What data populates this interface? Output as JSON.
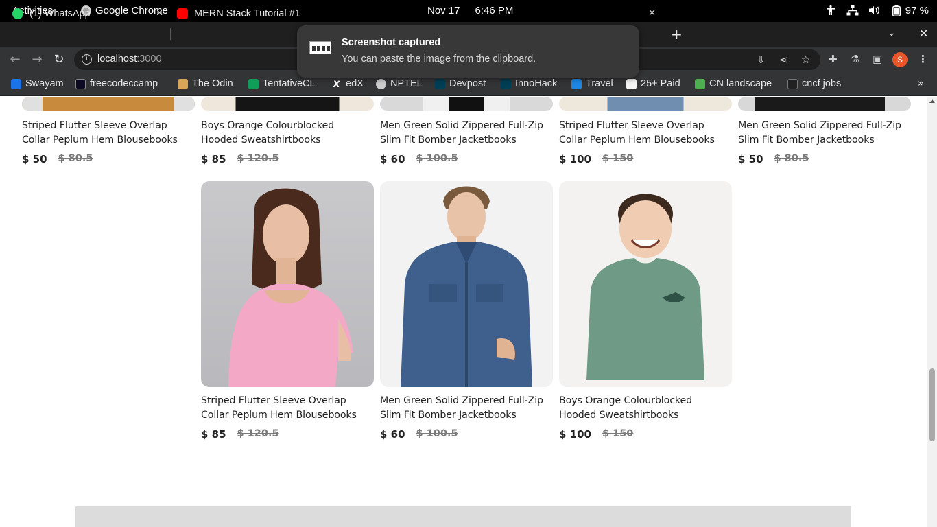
{
  "topbar": {
    "activities": "Activities",
    "app_name": "Google Chrome",
    "date": "Nov 17",
    "time": "6:46 PM",
    "battery": "97 %"
  },
  "tabs": [
    {
      "label": "(1) WhatsApp",
      "favicon_color": "#25d366"
    },
    {
      "label": "MERN Stack Tutorial #1",
      "favicon_color": "#ff0000"
    }
  ],
  "toolbar": {
    "url_host": "localhost",
    "url_port": ":3000",
    "profile_initial": "S"
  },
  "bookmarks": [
    {
      "label": "Swayam",
      "icon_color": "#1a73e8"
    },
    {
      "label": "freecodeccamp",
      "icon_color": "#0a0a23"
    },
    {
      "label": "The Odin",
      "icon_color": "#d9a657"
    },
    {
      "label": "TentativeCL",
      "icon_color": "#0f9d58"
    },
    {
      "label": "edX",
      "icon_color": "#333436"
    },
    {
      "label": "NPTEL",
      "icon_color": "#cccccc"
    },
    {
      "label": "Devpost",
      "icon_color": "#003e54"
    },
    {
      "label": "InnoHack",
      "icon_color": "#003e54"
    },
    {
      "label": "Travel",
      "icon_color": "#1e88e5"
    },
    {
      "label": "25+ Paid",
      "icon_color": "#f5f5f5"
    },
    {
      "label": "CN landscape",
      "icon_color": "#4caf50"
    },
    {
      "label": "cncf jobs",
      "icon_color": "#222222"
    }
  ],
  "notification": {
    "title": "Screenshot captured",
    "body": "You can paste the image from the clipboard."
  },
  "products_top_row": [
    {
      "title": "Striped Flutter Sleeve Overlap Collar Peplum Hem Blousebooks",
      "price": "$ 50",
      "old_price": "$ 80.5"
    },
    {
      "title": "Boys Orange Colourblocked Hooded Sweatshirtbooks",
      "price": "$ 85",
      "old_price": "$ 120.5"
    },
    {
      "title": "Men Green Solid Zippered Full-Zip Slim Fit Bomber Jacketbooks",
      "price": "$ 60",
      "old_price": "$ 100.5"
    },
    {
      "title": "Striped Flutter Sleeve Overlap Collar Peplum Hem Blousebooks",
      "price": "$ 100",
      "old_price": "$ 150"
    },
    {
      "title": "Men Green Solid Zippered Full-Zip Slim Fit Bomber Jacketbooks",
      "price": "$ 50",
      "old_price": "$ 80.5"
    }
  ],
  "products_second_row": [
    {
      "title": "Striped Flutter Sleeve Overlap Collar Peplum Hem Blousebooks",
      "price": "$ 85",
      "old_price": "$ 120.5"
    },
    {
      "title": "Men Green Solid Zippered Full-Zip Slim Fit Bomber Jacketbooks",
      "price": "$ 60",
      "old_price": "$ 100.5"
    },
    {
      "title": "Boys Orange Colourblocked Hooded Sweatshirtbooks",
      "price": "$ 100",
      "old_price": "$ 150"
    }
  ]
}
